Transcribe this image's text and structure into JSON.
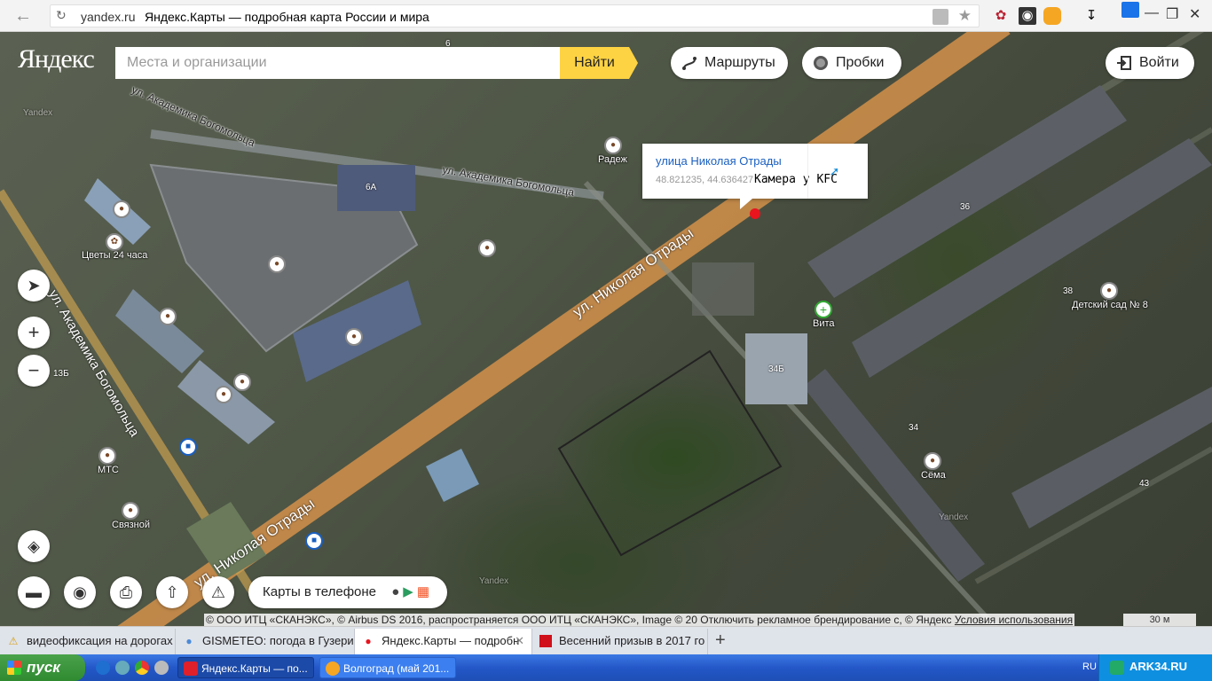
{
  "browser": {
    "back_icon": "arrow-left-icon",
    "reload_icon": "reload-icon",
    "domain": "yandex.ru",
    "title": "Яндекс.Карты — подробная карта России и мира",
    "lock_icon": "lock-icon",
    "bookmark_icon": "star-icon",
    "extensions": [
      "ladybug-icon",
      "location-icon",
      "chat-icon"
    ],
    "download_icon": "download-icon",
    "window_controls": [
      "sync-icon",
      "minimize-icon",
      "restore-icon",
      "close-icon"
    ]
  },
  "header": {
    "logo": "Яндекс",
    "search_placeholder": "Места и организации",
    "find_label": "Найти",
    "routes_label": "Маршруты",
    "traffic_label": "Пробки",
    "login_label": "Войти"
  },
  "balloon": {
    "title": "улица Николая Отрады",
    "coords": "48.821235, 44.636427",
    "note": "Камера у KFC",
    "share_icon": "share-icon"
  },
  "map_labels": {
    "streets": [
      "ул. Николая Отрады",
      "ул. Николая Отрады",
      "ул. Академика Богомольца",
      "ул. Академика Богомольца",
      "ул. Академика Богомольца"
    ],
    "places": [
      "Радеж",
      "Цветы 24 часа",
      "Вита",
      "Детский сад № 8",
      "МТС",
      "Связной",
      "Сёма"
    ],
    "houses": [
      "6",
      "6А",
      "36",
      "38",
      "34Б",
      "34",
      "43",
      "13Б"
    ],
    "watermarks": [
      "Yandex",
      "Yandex",
      "Yandex"
    ]
  },
  "controls": {
    "locate_icon": "locate-icon",
    "zoom_in": "+",
    "zoom_out": "−",
    "layers_icon": "layers-icon",
    "ruler_icon": "ruler-icon",
    "panorama_icon": "binoculars-icon",
    "print_icon": "print-icon",
    "share_icon": "share-icon",
    "report_icon": "warning-icon",
    "phone_label": "Карты в телефоне",
    "store_icons": [
      "apple-icon",
      "google-play-icon",
      "windows-icon"
    ]
  },
  "footer": {
    "copyright": "© ООО ИТЦ «СКАНЭКС», © Airbus DS 2016, распространяется ООО ИТЦ «СКАНЭКС», Image © 20",
    "advertising": "Отключить рекламное брендирование",
    "copyright_tail": "с, © Яндекс",
    "terms": "Условия использования",
    "scale": "30 м"
  },
  "tabs": [
    {
      "label": "видеофиксация на дорогах",
      "icon": "warning-icon",
      "active": false
    },
    {
      "label": "GISMETEO: погода в Гузери",
      "icon": "globe-icon",
      "active": false
    },
    {
      "label": "Яндекс.Карты — подробн",
      "icon": "map-pin-icon",
      "active": true
    },
    {
      "label": "Весенний призыв в 2017 го",
      "icon": "red-square-icon",
      "active": false
    }
  ],
  "new_tab_label": "+",
  "taskbar": {
    "start_label": "пуск",
    "tasks": [
      {
        "label": "Яндекс.Карты — по...",
        "active": true
      },
      {
        "label": "Волгоград (май 201...",
        "active": false
      }
    ],
    "language": "RU",
    "tray_text": "ARK34.RU"
  }
}
